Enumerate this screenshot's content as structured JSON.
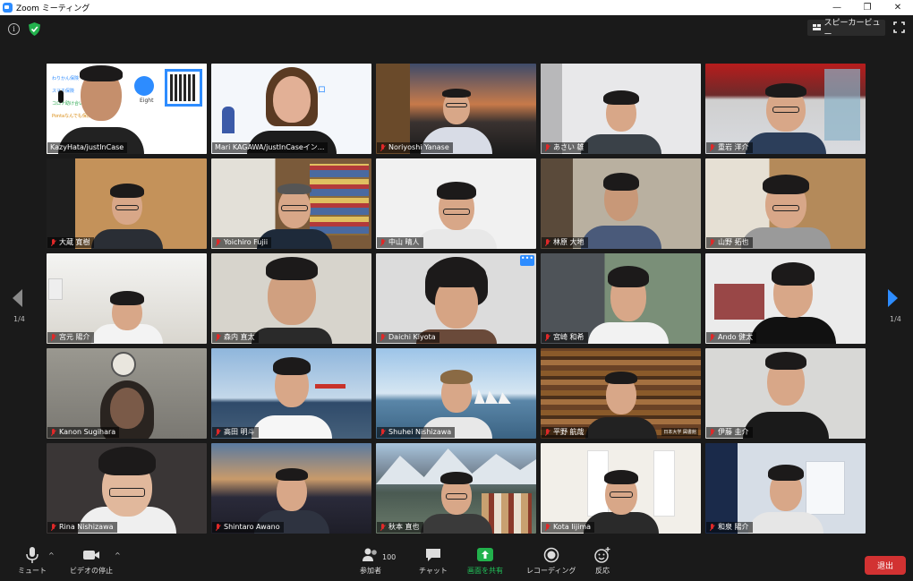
{
  "window": {
    "title": "Zoom ミーティング",
    "minimize": "—",
    "restore": "❐",
    "close": "✕"
  },
  "topbar": {
    "info": "i",
    "speaker_view": "スピーカービュー"
  },
  "pagination": {
    "prev_label": "1/4",
    "next_label": "1/4"
  },
  "participants": [
    {
      "name": "KazyHata/justInCase",
      "muted": false,
      "active": true
    },
    {
      "name": "Mari KAGAWA/justInCaseイン...",
      "muted": false
    },
    {
      "name": "Noriyoshi Yanase",
      "muted": true
    },
    {
      "name": "あさい 雄",
      "muted": true
    },
    {
      "name": "重岩 洋介",
      "muted": true
    },
    {
      "name": "大蔵 寛樹",
      "muted": true
    },
    {
      "name": "Yoichiro Fujii",
      "muted": true
    },
    {
      "name": "中山 晴人",
      "muted": true
    },
    {
      "name": "林原 大地",
      "muted": true
    },
    {
      "name": "山野 拓也",
      "muted": true
    },
    {
      "name": "宮元 陽介",
      "muted": true
    },
    {
      "name": "森内 直太",
      "muted": true
    },
    {
      "name": "Daichi Kiyota",
      "muted": true
    },
    {
      "name": "宮崎 和希",
      "muted": true
    },
    {
      "name": "Ando 健太",
      "muted": true
    },
    {
      "name": "Kanon Sugihara",
      "muted": true
    },
    {
      "name": "高田 明斗",
      "muted": true
    },
    {
      "name": "Shuhei Nishizawa",
      "muted": true
    },
    {
      "name": "平野 航哉",
      "muted": true
    },
    {
      "name": "伊藤 圭介",
      "muted": true
    },
    {
      "name": "Rina Nishizawa",
      "muted": true
    },
    {
      "name": "Shintaro Awano",
      "muted": true
    },
    {
      "name": "秋本 直也",
      "muted": true
    },
    {
      "name": "Kota Iijima",
      "muted": true
    },
    {
      "name": "和泉 陽介",
      "muted": true
    }
  ],
  "slide": {
    "items": [
      "わりかん保険",
      "スマホ保険",
      "コロナ助け合い保険",
      "Pontaなんでも保険"
    ],
    "logo": "Eight"
  },
  "background_caption": "日本大学 図書館",
  "more_label": "•••",
  "toolbar": {
    "mute": "ミュート",
    "video": "ビデオの停止",
    "participants": "参加者",
    "participants_count": "100",
    "chat": "チャット",
    "share": "画面を共有",
    "record": "レコーディング",
    "reactions": "反応",
    "leave": "退出",
    "caret": "^"
  },
  "colors": {
    "active_border": "#d5e55a",
    "share_green": "#22b14c",
    "leave_red": "#d23232",
    "nav_blue": "#2d8cff"
  }
}
